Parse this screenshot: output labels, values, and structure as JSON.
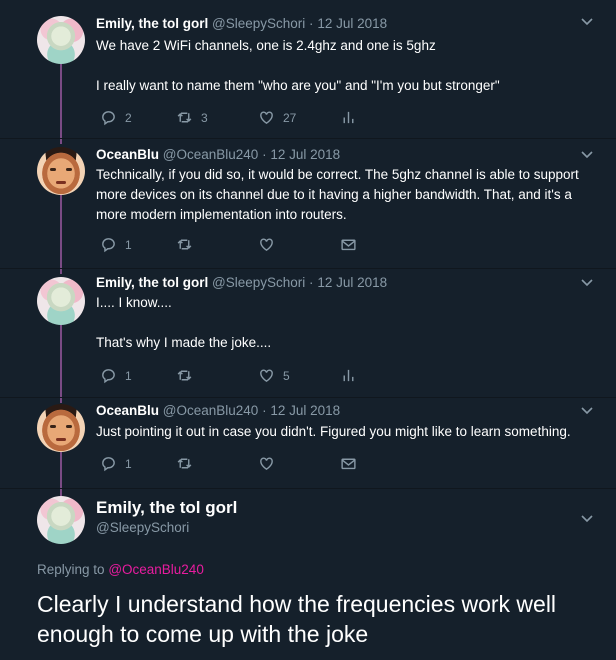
{
  "tweets": [
    {
      "name": "Emily, the tol gorl",
      "handle": "@SleepySchori",
      "date": "12 Jul 2018",
      "lines": [
        "We have 2 WiFi channels, one is 2.4ghz and one is 5ghz",
        "",
        "I really want to name them \"who are you\" and \"I'm you but stronger\""
      ],
      "replies": "2",
      "retweets": "3",
      "likes": "27"
    },
    {
      "name": "OceanBlu",
      "handle": "@OceanBlu240",
      "date": "12 Jul 2018",
      "lines": [
        "Technically, if you did so, it would be correct. The 5ghz channel is able to support more devices on its channel due to it having a higher bandwidth. That, and it's a more modern implementation into routers."
      ],
      "replies": "1",
      "retweets": "",
      "likes": ""
    },
    {
      "name": "Emily, the tol gorl",
      "handle": "@SleepySchori",
      "date": "12 Jul 2018",
      "lines": [
        "I.... I know....",
        "",
        "That's why I made the joke...."
      ],
      "replies": "1",
      "retweets": "",
      "likes": "5"
    },
    {
      "name": "OceanBlu",
      "handle": "@OceanBlu240",
      "date": "12 Jul 2018",
      "lines": [
        "Just pointing it out in case you didn't. Figured you might like to learn something."
      ],
      "replies": "1",
      "retweets": "",
      "likes": ""
    }
  ],
  "focused": {
    "name": "Emily, the tol gorl",
    "handle": "@SleepySchori",
    "replying_prefix": "Replying to",
    "replying_to": "@OceanBlu240",
    "text": "Clearly I understand how the frequencies work well enough to come up with the joke"
  },
  "separator": "·",
  "chevron": "⌄"
}
